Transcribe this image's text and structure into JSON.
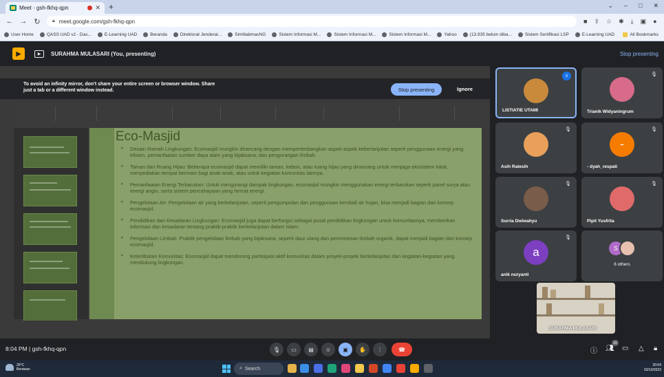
{
  "browser": {
    "tab_title": "Meet - gsh-fkhq-qpn",
    "new_tab": "+",
    "window_controls": [
      "⌄",
      "–",
      "□",
      "✕"
    ],
    "url": "meet.google.com/gsh-fkhq-qpn",
    "bookmarks": [
      "User Home",
      "QASS UAD v2 - Das...",
      "E-Learning UAD",
      "Beranda",
      "Direktorat Jenderal...",
      "SimlitabmasNG",
      "Sistem Informasi M...",
      "Sistem Informasi M...",
      "Sistem Informasi M...",
      "Yahoo",
      "(13.935 belum diba...",
      "Sistem Sertifikasi LSP",
      "E-Learning UAD"
    ],
    "bookmarks_right": "All Bookmarks"
  },
  "meet_top": {
    "presenter_label": "SURAHMA MULASARI (You, presenting)",
    "stop_presenting": "Stop presenting"
  },
  "share_banner": {
    "warning": "To avoid an infinity mirror, don't share your entire screen or browser window. Share just a tab or a different window instead.",
    "stop_button": "Stop presenting",
    "ignore_button": "Ignore"
  },
  "slide": {
    "title": "Eco-Masjid",
    "bullets": [
      "Desain Ramah Lingkungan: Ecomasjid mungkin dirancang dengan mempertimbangkan aspek-aspek keberlanjutan seperti penggunaan energi yang efisien, pemanfaatan sumber daya alam yang bijaksana, dan pengurangan limbah.",
      "Taman dan Ruang Hijau: Beberapa ecomasjid dapat memiliki taman, kebun, atau ruang hijau yang dirancang untuk menjaga ekosistem lokal, menyediakan tempat bermain bagi anak-anak, atau untuk kegiatan komunitas lainnya.",
      "Pemanfaatan Energi Terbarukan: Untuk mengurangi dampak lingkungan, ecomasjid mungkin menggunakan energi terbarukan seperti panel surya atau energi angin, serta sistem pencahayaan yang hemat energi.",
      "Pengelolaan Air: Pengelolaan air yang berkelanjutan, seperti pengumpulan dan penggunaan kembali air hujan, bisa menjadi bagian dari konsep ecomasjid.",
      "Pendidikan dan Kesadaran Lingkungan: Ecomasjid juga dapat berfungsi sebagai pusat pendidikan lingkungan untuk komunitasnya, memberikan informasi dan kesadaran tentang praktik-praktik berkelanjutan dalam Islam.",
      "Pengelolaan Limbah: Praktik pengelolaan limbah yang bijaksana, seperti daur ulang dan pemrosesan limbah organik, dapat menjadi bagian dari konsep ecomasjid.",
      "Keterlibatan Komunitas: Ecomasjid dapat mendorong partisipasi aktif komunitas dalam proyek-proyek berkelanjutan dan kegiatan-kegiatan yang mendukung lingkungan."
    ]
  },
  "participants": [
    {
      "name": "LISTIATIE UTAMI",
      "letter": "",
      "color": "#c98a3c",
      "speaking": true
    },
    {
      "name": "Trianik Widyaningrum",
      "letter": "",
      "color": "#d86a8a",
      "speaking": false
    },
    {
      "name": "Asih Ratesih",
      "letter": "",
      "color": "#e8a05a",
      "speaking": false
    },
    {
      "name": "- dyah_respati",
      "letter": "-",
      "color": "#f57c00",
      "speaking": false
    },
    {
      "name": "Surria Dwiwahyu",
      "letter": "",
      "color": "#7a5c4a",
      "speaking": false
    },
    {
      "name": "Pipit Yusfrita",
      "letter": "",
      "color": "#e06a6a",
      "speaking": false
    },
    {
      "name": "anik nuryanti",
      "letter": "a",
      "color": "#7b3fbf",
      "speaking": false
    }
  ],
  "others": {
    "letter": "S",
    "label": "6 others"
  },
  "self_view": {
    "name": "SURAHMA MULASARI"
  },
  "meet_bottom": {
    "time": "8:04 PM",
    "separator": "|",
    "meeting_code": "gsh-fkhq-qpn",
    "participant_count": "16"
  },
  "taskbar": {
    "temperature": "26°C",
    "weather": "Berawan",
    "search": "Search",
    "time": "20:04",
    "date": "03/10/2023"
  },
  "colors": {
    "accent": "#8ab4f8",
    "end_call": "#ea4335",
    "meet_bg": "#202124"
  }
}
